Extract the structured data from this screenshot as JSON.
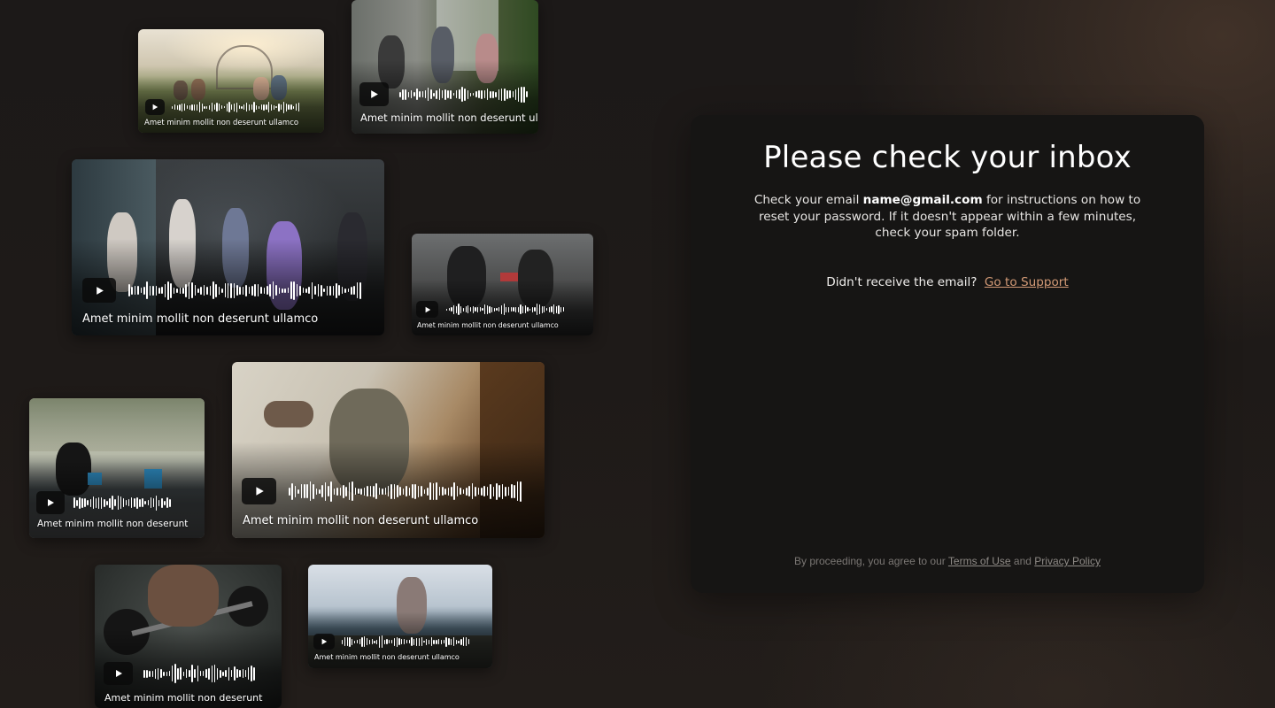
{
  "colors": {
    "background": "#1e1a18",
    "panel": "#161514",
    "accent_link": "#d39a76",
    "muted_text": "#7b7774"
  },
  "media_cards": [
    {
      "caption": "Amet minim mollit non deserunt ullamco",
      "play_icon": "play-icon"
    },
    {
      "caption": "Amet minim mollit non deserunt",
      "play_icon": "play-icon"
    },
    {
      "caption": "Amet minim mollit non deserunt ullamco",
      "play_icon": "play-icon"
    },
    {
      "caption": "Amet minim mollit non deserunt ullamco",
      "play_icon": "play-icon"
    },
    {
      "caption": "Amet minim mollit non deserunt",
      "play_icon": "play-icon"
    },
    {
      "caption": "Amet minim mollit non deserunt ullamco",
      "play_icon": "play-icon"
    },
    {
      "caption": "Amet minim mollit non deserunt",
      "play_icon": "play-icon"
    },
    {
      "caption": "Amet minim mollit non deserunt ullamco",
      "play_icon": "play-icon"
    }
  ],
  "panel": {
    "title": "Please check your inbox",
    "message_prefix": "Check your email ",
    "email": "name@gmail.com",
    "message_suffix": " for instructions on how to reset your password. If it doesn't appear within a few minutes, check your spam folder.",
    "resend_prompt": "Didn't receive the email?",
    "support_link": "Go to Support",
    "legal_prefix": "By proceeding, you agree to our ",
    "terms_link": "Terms of Use",
    "legal_and": " and ",
    "privacy_link": "Privacy Policy"
  }
}
